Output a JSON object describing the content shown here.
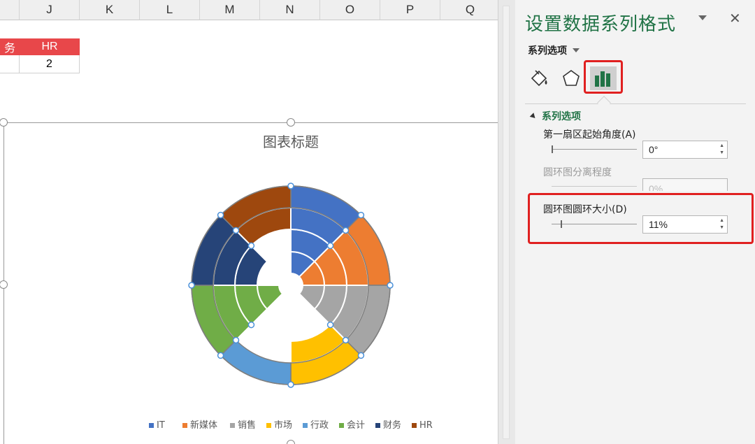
{
  "columns": [
    "",
    "J",
    "K",
    "L",
    "M",
    "N",
    "O",
    "P",
    "Q"
  ],
  "table": {
    "header_left": "务",
    "header_right": "HR",
    "value_right": "2",
    "header_color": "#e8474a"
  },
  "chart": {
    "title": "图表标题"
  },
  "chart_data": {
    "type": "pie",
    "title": "图表标题",
    "categories": [
      "IT",
      "新媒体",
      "销售",
      "市场",
      "行政",
      "会计",
      "财务",
      "HR"
    ],
    "colors": [
      "#4472c4",
      "#ed7d31",
      "#a5a5a5",
      "#ffc000",
      "#5b9bd5",
      "#70ad47",
      "#264478",
      "#9e480e"
    ],
    "rings": [
      {
        "name": "",
        "values": [
          1,
          1,
          1,
          0,
          0,
          1,
          0,
          0
        ]
      },
      {
        "name": "",
        "values": [
          1,
          1,
          1,
          0,
          0,
          1,
          1,
          0
        ]
      },
      {
        "name": "",
        "values": [
          1,
          1,
          1,
          1,
          0,
          1,
          1,
          1
        ]
      },
      {
        "name": "",
        "values": [
          1,
          1,
          1,
          1,
          1,
          1,
          1,
          1
        ]
      }
    ],
    "legend_position": "bottom"
  },
  "panel": {
    "title": "设置数据系列格式",
    "close": "✕",
    "series_options_dropdown": "系列选项",
    "section_header": "系列选项",
    "first_slice_angle_label": "第一扇区起始角度(A)",
    "first_slice_angle_value": "0°",
    "doughnut_explosion_label": "圆环图分离程度",
    "doughnut_explosion_value": "0%",
    "doughnut_hole_label": "圆环图圆环大小(D)",
    "doughnut_hole_value": "11%",
    "hole_level": 0.11
  }
}
